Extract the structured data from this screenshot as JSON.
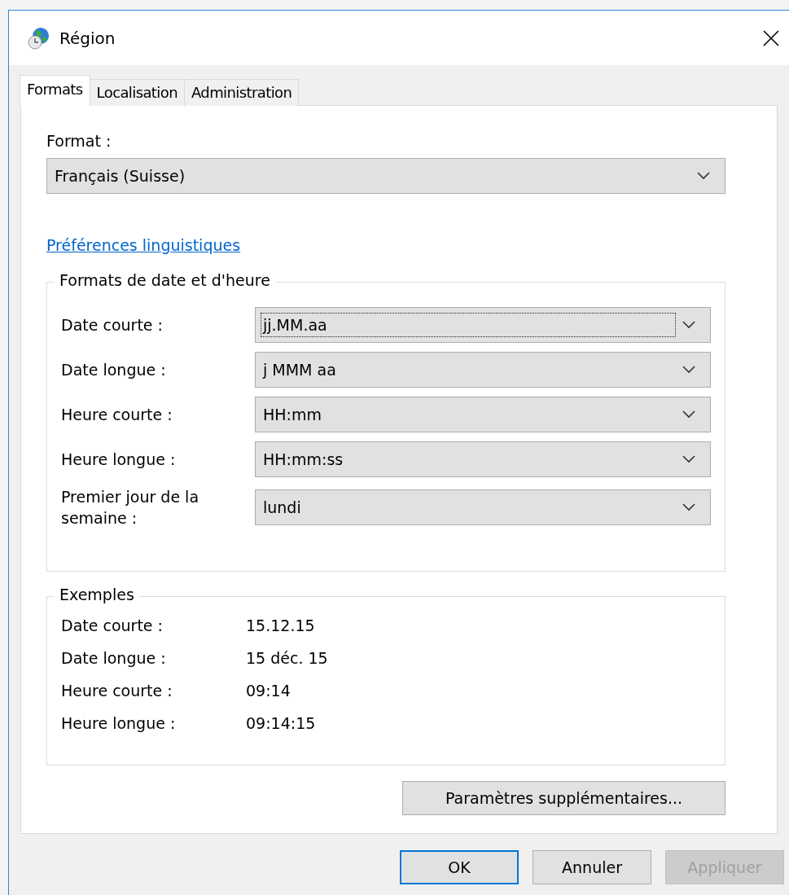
{
  "window": {
    "title": "Région"
  },
  "tabs": [
    {
      "label": "Formats",
      "selected": true
    },
    {
      "label": "Localisation",
      "selected": false
    },
    {
      "label": "Administration",
      "selected": false
    }
  ],
  "format": {
    "label": "Format :",
    "value": "Français (Suisse)"
  },
  "link": "Préférences linguistiques",
  "date_time_formats": {
    "title": "Formats de date et d'heure",
    "rows": [
      {
        "label": "Date courte :",
        "value": "jj.MM.aa",
        "focused": true
      },
      {
        "label": "Date longue :",
        "value": "j MMM aa",
        "focused": false
      },
      {
        "label": "Heure courte :",
        "value": "HH:mm",
        "focused": false
      },
      {
        "label": "Heure longue :",
        "value": "HH:mm:ss",
        "focused": false
      },
      {
        "label": "Premier jour de la semaine :",
        "value": "lundi",
        "focused": false
      }
    ]
  },
  "examples": {
    "title": "Exemples",
    "rows": [
      {
        "label": "Date courte :",
        "value": "15.12.15"
      },
      {
        "label": "Date longue :",
        "value": "15 déc. 15"
      },
      {
        "label": "Heure courte :",
        "value": "09:14"
      },
      {
        "label": "Heure longue :",
        "value": "09:14:15"
      }
    ]
  },
  "advanced_button": "Paramètres supplémentaires...",
  "buttons": [
    {
      "label": "OK",
      "default": true,
      "disabled": false
    },
    {
      "label": "Annuler",
      "default": false,
      "disabled": false
    },
    {
      "label": "Appliquer",
      "default": false,
      "disabled": true
    }
  ]
}
